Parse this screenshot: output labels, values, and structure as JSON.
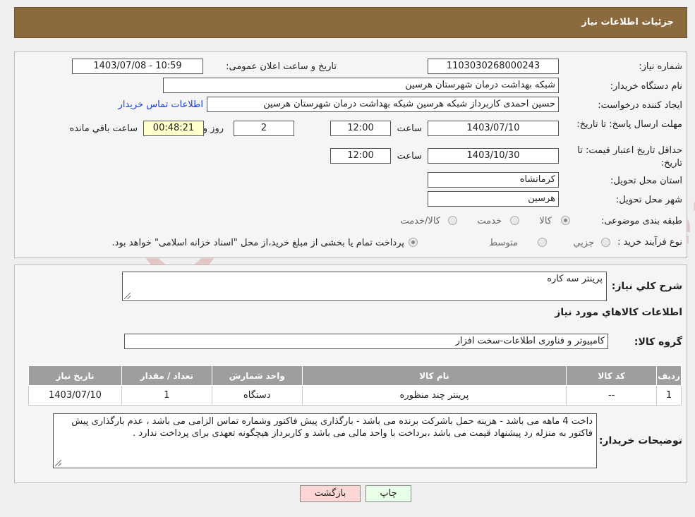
{
  "header": {
    "title": "جزئیات اطلاعات نیاز"
  },
  "form": {
    "need_number_label": "شماره نیاز:",
    "need_number": "1103030268000243",
    "announce_label": "تاریخ و ساعت اعلان عمومی:",
    "announce_value": "1403/07/08 - 10:59",
    "buyer_org_label": "نام دستگاه خریدار:",
    "buyer_org": "شبکه بهداشت درمان شهرستان هرسین",
    "creator_label": "ایجاد کننده درخواست:",
    "creator": "حسین احمدی کاربرداز شبکه هرسین شبکه بهداشت درمان شهرستان هرسین",
    "contact_link": "اطلاعات تماس خریدار",
    "deadline_label": "مهلت ارسال پاسخ: تا تاریخ:",
    "deadline_date": "1403/07/10",
    "time_label": "ساعت",
    "deadline_time": "12:00",
    "days_value": "2",
    "days_label": "روز و",
    "remaining_time": "00:48:21",
    "remaining_label": "ساعت باقي مانده",
    "validity_label": "حداقل تاریخ اعتبار قیمت: تا تاریخ:",
    "validity_date": "1403/10/30",
    "validity_time": "12:00",
    "province_label": "استان محل تحویل:",
    "province": "کرمانشاه",
    "city_label": "شهر محل تحویل:",
    "city": "هرسین",
    "category_label": "طبقه بندی موضوعی:",
    "category_options": [
      "کالا",
      "خدمت",
      "کالا/خدمت"
    ],
    "purchase_type_label": "نوع فرآیند خرید :",
    "purchase_options": [
      "جزيي",
      "متوسط"
    ],
    "purchase_note": "پرداخت تمام یا بخشی از مبلغ خرید،از محل \"اسناد خزانه اسلامی\" خواهد بود."
  },
  "details": {
    "summary_label": "شرح كلي نياز:",
    "summary": "پرینتر سه کاره",
    "goods_info_title": "اطلاعات کالاهاي مورد نياز",
    "goods_group_label": "گروه کالا:",
    "goods_group": "کامپیوتر و فناوری اطلاعات-سخت افزار"
  },
  "table": {
    "headers": [
      "رديف",
      "کد کالا",
      "نام کالا",
      "واحد شمارش",
      "تعداد / مقدار",
      "تاریخ نیاز"
    ],
    "rows": [
      [
        "1",
        "--",
        "پرینتر چند منظوره",
        "دستگاه",
        "1",
        "1403/07/10"
      ]
    ]
  },
  "buyer_notes": {
    "label": "توضیحات خریدار:",
    "text": "داخت 4 ماهه می باشد - هزینه حمل باشرکت برنده می باشد - بارگذاری پیش فاکتور وشماره تماس الزامی می باشد ، عدم بارگذاری پیش فاکتور به منزله رد پیشنهاد قیمت می باشد ،برداخت با واحد مالی می باشد و کاربرداز هیچگونه تعهدی برای پرداخت ندارد ."
  },
  "buttons": {
    "print": "چاپ",
    "back": "بازگشت"
  },
  "colors": {
    "header_bg": "#8b6a3e",
    "back_button_bg": "#ffd6d6",
    "print_button_bg": "#e6ffe6",
    "link": "#1a3fd8"
  }
}
